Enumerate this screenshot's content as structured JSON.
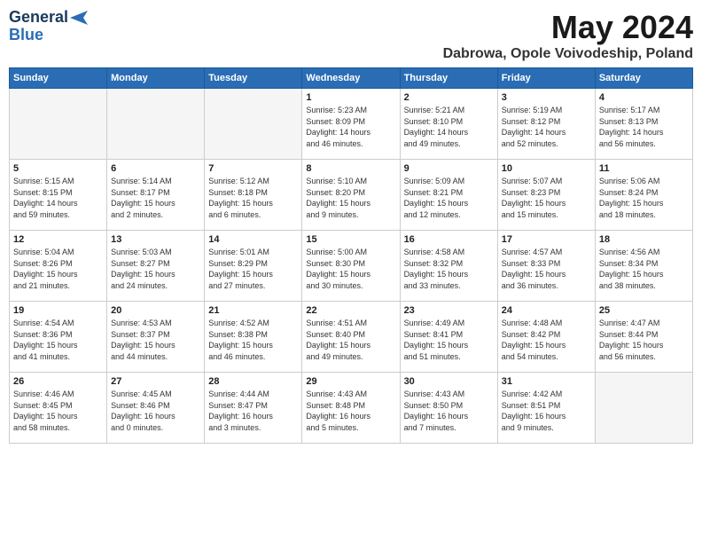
{
  "header": {
    "logo_line1": "General",
    "logo_line2": "Blue",
    "month_title": "May 2024",
    "location": "Dabrowa, Opole Voivodeship, Poland"
  },
  "weekdays": [
    "Sunday",
    "Monday",
    "Tuesday",
    "Wednesday",
    "Thursday",
    "Friday",
    "Saturday"
  ],
  "weeks": [
    {
      "shade": false,
      "days": [
        {
          "num": "",
          "info": ""
        },
        {
          "num": "",
          "info": ""
        },
        {
          "num": "",
          "info": ""
        },
        {
          "num": "1",
          "info": "Sunrise: 5:23 AM\nSunset: 8:09 PM\nDaylight: 14 hours\nand 46 minutes."
        },
        {
          "num": "2",
          "info": "Sunrise: 5:21 AM\nSunset: 8:10 PM\nDaylight: 14 hours\nand 49 minutes."
        },
        {
          "num": "3",
          "info": "Sunrise: 5:19 AM\nSunset: 8:12 PM\nDaylight: 14 hours\nand 52 minutes."
        },
        {
          "num": "4",
          "info": "Sunrise: 5:17 AM\nSunset: 8:13 PM\nDaylight: 14 hours\nand 56 minutes."
        }
      ]
    },
    {
      "shade": true,
      "days": [
        {
          "num": "5",
          "info": "Sunrise: 5:15 AM\nSunset: 8:15 PM\nDaylight: 14 hours\nand 59 minutes."
        },
        {
          "num": "6",
          "info": "Sunrise: 5:14 AM\nSunset: 8:17 PM\nDaylight: 15 hours\nand 2 minutes."
        },
        {
          "num": "7",
          "info": "Sunrise: 5:12 AM\nSunset: 8:18 PM\nDaylight: 15 hours\nand 6 minutes."
        },
        {
          "num": "8",
          "info": "Sunrise: 5:10 AM\nSunset: 8:20 PM\nDaylight: 15 hours\nand 9 minutes."
        },
        {
          "num": "9",
          "info": "Sunrise: 5:09 AM\nSunset: 8:21 PM\nDaylight: 15 hours\nand 12 minutes."
        },
        {
          "num": "10",
          "info": "Sunrise: 5:07 AM\nSunset: 8:23 PM\nDaylight: 15 hours\nand 15 minutes."
        },
        {
          "num": "11",
          "info": "Sunrise: 5:06 AM\nSunset: 8:24 PM\nDaylight: 15 hours\nand 18 minutes."
        }
      ]
    },
    {
      "shade": false,
      "days": [
        {
          "num": "12",
          "info": "Sunrise: 5:04 AM\nSunset: 8:26 PM\nDaylight: 15 hours\nand 21 minutes."
        },
        {
          "num": "13",
          "info": "Sunrise: 5:03 AM\nSunset: 8:27 PM\nDaylight: 15 hours\nand 24 minutes."
        },
        {
          "num": "14",
          "info": "Sunrise: 5:01 AM\nSunset: 8:29 PM\nDaylight: 15 hours\nand 27 minutes."
        },
        {
          "num": "15",
          "info": "Sunrise: 5:00 AM\nSunset: 8:30 PM\nDaylight: 15 hours\nand 30 minutes."
        },
        {
          "num": "16",
          "info": "Sunrise: 4:58 AM\nSunset: 8:32 PM\nDaylight: 15 hours\nand 33 minutes."
        },
        {
          "num": "17",
          "info": "Sunrise: 4:57 AM\nSunset: 8:33 PM\nDaylight: 15 hours\nand 36 minutes."
        },
        {
          "num": "18",
          "info": "Sunrise: 4:56 AM\nSunset: 8:34 PM\nDaylight: 15 hours\nand 38 minutes."
        }
      ]
    },
    {
      "shade": true,
      "days": [
        {
          "num": "19",
          "info": "Sunrise: 4:54 AM\nSunset: 8:36 PM\nDaylight: 15 hours\nand 41 minutes."
        },
        {
          "num": "20",
          "info": "Sunrise: 4:53 AM\nSunset: 8:37 PM\nDaylight: 15 hours\nand 44 minutes."
        },
        {
          "num": "21",
          "info": "Sunrise: 4:52 AM\nSunset: 8:38 PM\nDaylight: 15 hours\nand 46 minutes."
        },
        {
          "num": "22",
          "info": "Sunrise: 4:51 AM\nSunset: 8:40 PM\nDaylight: 15 hours\nand 49 minutes."
        },
        {
          "num": "23",
          "info": "Sunrise: 4:49 AM\nSunset: 8:41 PM\nDaylight: 15 hours\nand 51 minutes."
        },
        {
          "num": "24",
          "info": "Sunrise: 4:48 AM\nSunset: 8:42 PM\nDaylight: 15 hours\nand 54 minutes."
        },
        {
          "num": "25",
          "info": "Sunrise: 4:47 AM\nSunset: 8:44 PM\nDaylight: 15 hours\nand 56 minutes."
        }
      ]
    },
    {
      "shade": false,
      "days": [
        {
          "num": "26",
          "info": "Sunrise: 4:46 AM\nSunset: 8:45 PM\nDaylight: 15 hours\nand 58 minutes."
        },
        {
          "num": "27",
          "info": "Sunrise: 4:45 AM\nSunset: 8:46 PM\nDaylight: 16 hours\nand 0 minutes."
        },
        {
          "num": "28",
          "info": "Sunrise: 4:44 AM\nSunset: 8:47 PM\nDaylight: 16 hours\nand 3 minutes."
        },
        {
          "num": "29",
          "info": "Sunrise: 4:43 AM\nSunset: 8:48 PM\nDaylight: 16 hours\nand 5 minutes."
        },
        {
          "num": "30",
          "info": "Sunrise: 4:43 AM\nSunset: 8:50 PM\nDaylight: 16 hours\nand 7 minutes."
        },
        {
          "num": "31",
          "info": "Sunrise: 4:42 AM\nSunset: 8:51 PM\nDaylight: 16 hours\nand 9 minutes."
        },
        {
          "num": "",
          "info": ""
        }
      ]
    }
  ]
}
